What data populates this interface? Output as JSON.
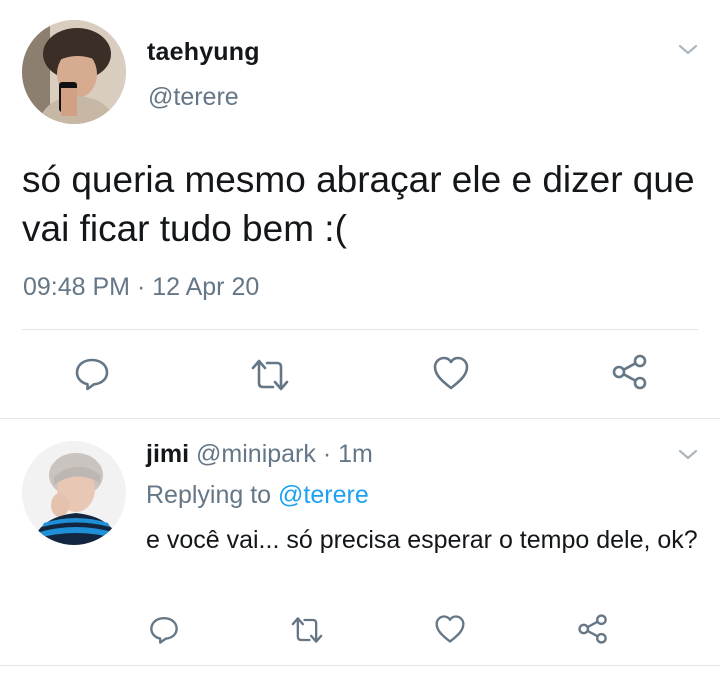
{
  "main_tweet": {
    "display_name": "taehyung",
    "handle": "@terere",
    "text": "só queria mesmo abraçar ele e dizer que vai ficar tudo bem :(",
    "timestamp": "09:48 PM · 12 Apr 20",
    "avatar": "user-avatar-photo",
    "icons": [
      "reply-icon",
      "retweet-icon",
      "like-icon",
      "share-icon",
      "chevron-down-icon"
    ]
  },
  "reply_tweet": {
    "display_name": "jimi",
    "handle": "@minipark",
    "separator": " · ",
    "age": "1m",
    "replying_to_label": "Replying to",
    "replying_to_handle": "@terere",
    "text": "e você vai... só precisa esperar o tempo dele, ok?",
    "avatar": "user-avatar-photo",
    "icons": [
      "reply-icon",
      "retweet-icon",
      "like-icon",
      "share-icon",
      "chevron-down-icon"
    ]
  },
  "colors": {
    "text_primary": "#14171a",
    "text_secondary": "#657786",
    "link": "#1da1f2",
    "divider": "#e1e8ed",
    "icon": "#657786"
  }
}
